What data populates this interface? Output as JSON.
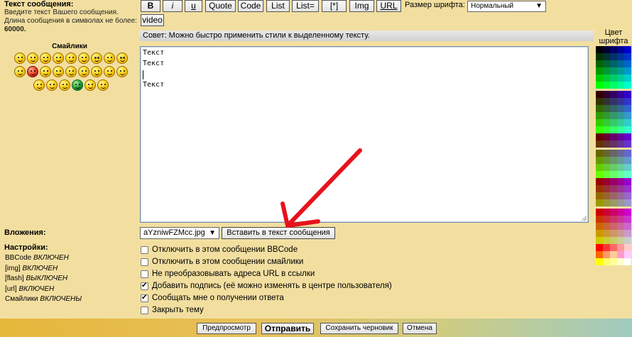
{
  "left": {
    "message_title": "Текст сообщения:",
    "message_note": "Введите текст Вашего сообщения. Длина сообщения в символах не более:",
    "message_limit": "60000.",
    "smilies_title": "Смайлики",
    "attachments_label": "Вложения:",
    "settings_label": "Настройки:",
    "settings": [
      {
        "name": "BBCode",
        "state": "ВКЛЮЧЕН"
      },
      {
        "name": "[img]",
        "state": "ВКЛЮЧЕН"
      },
      {
        "name": "[flash]",
        "state": "ВЫКЛЮЧЕН"
      },
      {
        "name": "[url]",
        "state": "ВКЛЮЧЕН"
      },
      {
        "name": "Смайлики",
        "state": "ВКЛЮЧЕНЫ"
      }
    ]
  },
  "toolbar": {
    "bold": "B",
    "italic": "i",
    "underline": "u",
    "quote": "Quote",
    "code": "Code",
    "list": "List",
    "list_eq": "List=",
    "list_item": "[*]",
    "img": "Img",
    "url": "URL",
    "video": "video",
    "font_size_label": "Размер шрифта:",
    "font_size_value": "Нормальный"
  },
  "hint": "Совет: Можно быстро применить стили к выделенному тексту.",
  "editor": {
    "lines": [
      "Текст",
      "Текст",
      "",
      "Текст"
    ]
  },
  "color_panel": {
    "title_line1": "Цвет",
    "title_line2": "шрифта"
  },
  "attachments": {
    "file": "aYzniwFZMcc.jpg",
    "insert_button": "Вставить в текст сообщения"
  },
  "options": [
    {
      "label": "Отключить в этом сообщении BBCode",
      "checked": false
    },
    {
      "label": "Отключить в этом сообщении смайлики",
      "checked": false
    },
    {
      "label": "Не преобразовывать адреса URL в ссылки",
      "checked": false
    },
    {
      "label": "Добавить подпись (её можно изменять в центре пользователя)",
      "checked": true
    },
    {
      "label": "Сообщать мне о получении ответа",
      "checked": true
    },
    {
      "label": "Закрыть тему",
      "checked": false
    }
  ],
  "actions": {
    "preview": "Предпросмотр",
    "submit": "Отправить",
    "save_draft": "Сохранить черновик",
    "cancel": "Отмена"
  },
  "colors": {
    "background": "#f2dfa0",
    "annotation_arrow": "#e8121b"
  }
}
